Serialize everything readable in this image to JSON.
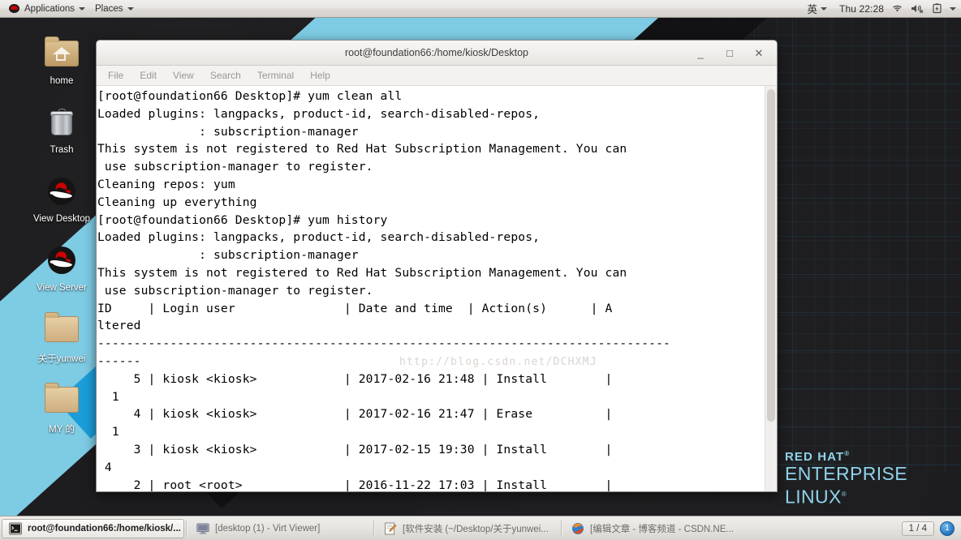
{
  "top_panel": {
    "applications_label": "Applications",
    "places_label": "Places",
    "ime_label": "英",
    "clock": "Thu 22:28",
    "icons": [
      "wifi-icon",
      "volume-muted-icon",
      "battery-icon",
      "caret-down-icon"
    ]
  },
  "desktop": {
    "icons": [
      {
        "label": "home",
        "icon": "home-folder-icon"
      },
      {
        "label": "Trash",
        "icon": "trash-icon"
      },
      {
        "label": "View Desktop",
        "icon": "redhat-shadowman-icon"
      },
      {
        "label": "View Server",
        "icon": "redhat-shadowman-icon"
      },
      {
        "label": "关于yunwei",
        "icon": "folder-icon"
      },
      {
        "label": "MY 的",
        "icon": "folder-icon"
      }
    ],
    "brand": {
      "line1": "RED HAT",
      "line2": "ENTERPRISE",
      "line3": "LINUX",
      "color": "#8fd3ea"
    }
  },
  "terminal": {
    "title": "root@foundation66:/home/kiosk/Desktop",
    "menu": [
      "File",
      "Edit",
      "View",
      "Search",
      "Terminal",
      "Help"
    ],
    "window_buttons": {
      "minimize": "_",
      "maximize": "□",
      "close": "✕"
    },
    "watermark": "http://blog.csdn.net/DCHXMJ",
    "content": "[root@foundation66 Desktop]# yum clean all\nLoaded plugins: langpacks, product-id, search-disabled-repos,\n              : subscription-manager\nThis system is not registered to Red Hat Subscription Management. You can\n use subscription-manager to register.\nCleaning repos: yum\nCleaning up everything\n[root@foundation66 Desktop]# yum history\nLoaded plugins: langpacks, product-id, search-disabled-repos,\n              : subscription-manager\nThis system is not registered to Red Hat Subscription Management. You can\n use subscription-manager to register.\nID     | Login user               | Date and time  | Action(s)      | A\nltered\n-------------------------------------------------------------------------------\n------\n     5 | kiosk <kiosk>            | 2017-02-16 21:48 | Install        |\n  1\n     4 | kiosk <kiosk>            | 2017-02-16 21:47 | Erase          |\n  1\n     3 | kiosk <kiosk>            | 2017-02-15 19:30 | Install        |\n 4\n     2 | root <root>              | 2016-11-22 17:03 | Install        |"
  },
  "taskbar": {
    "tasks": [
      {
        "label": "root@foundation66:/home/kiosk/...",
        "icon": "terminal-icon",
        "active": true
      },
      {
        "label": "[desktop (1) - Virt Viewer]",
        "icon": "monitor-icon",
        "active": false
      },
      {
        "label": "[软件安装 (~/Desktop/关于yunwei...",
        "icon": "editor-icon",
        "active": false
      },
      {
        "label": "[编辑文章 - 博客频道 - CSDN.NE...",
        "icon": "firefox-icon",
        "active": false
      }
    ],
    "pager_label": "1 / 4",
    "workspace_label": "1"
  }
}
